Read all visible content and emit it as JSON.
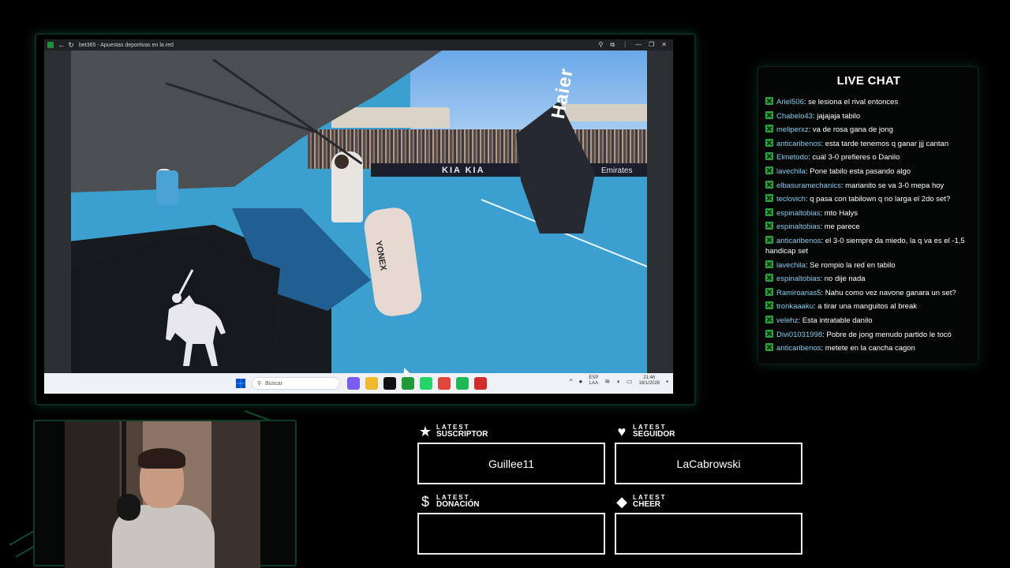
{
  "browser": {
    "tab_title": "bet365 - Apuestas deportivas en la red",
    "overlay_board_text": "KIA  KIA",
    "overlay_board_text2": "Emirates",
    "umpire_chair_text": "Haier",
    "bag_text": "YONEX"
  },
  "taskbar": {
    "search_placeholder": "Buscar",
    "lang_line1": "ESP",
    "lang_line2": "LAA",
    "time": "21:46",
    "date": "18/1/2026",
    "apps": [
      {
        "icon": "copilot-icon",
        "color": "#7b5cf0"
      },
      {
        "icon": "folder-icon",
        "color": "#f3b72a"
      },
      {
        "icon": "tiktok-icon",
        "color": "#111111"
      },
      {
        "icon": "kick-icon",
        "color": "#1f9a3b"
      },
      {
        "icon": "whatsapp-icon",
        "color": "#25d366"
      },
      {
        "icon": "chrome-icon",
        "color": "#e2463a"
      },
      {
        "icon": "spotify-icon",
        "color": "#1db954"
      },
      {
        "icon": "app-icon",
        "color": "#d32c2c"
      }
    ]
  },
  "chat": {
    "title": "LIVE CHAT",
    "messages": [
      {
        "user": "Ariel506",
        "text": ": se lesiona el rival entonces"
      },
      {
        "user": "Chabelo43",
        "text": ": jajajaja tabilo"
      },
      {
        "user": "meliperxz",
        "text": ": va de rosa gana de jong"
      },
      {
        "user": "anticaribenos",
        "text": ": esta tarde tenemos q ganar jjj cantan"
      },
      {
        "user": "Elmetodo",
        "text": ": cuál 3-0 prefieres o Danilo"
      },
      {
        "user": "lavechila",
        "text": ": Pone tabilo esta pasando algo"
      },
      {
        "user": "elbasuramechanics",
        "text": ": marianito se va 3-0 mepa hoy"
      },
      {
        "user": "teclovich",
        "text": ": q pasa con tabilown q no larga el 2do set?"
      },
      {
        "user": "espinaltobias",
        "text": ": mto Halys"
      },
      {
        "user": "espinaltobias",
        "text": ": me parece"
      },
      {
        "user": "anticaribenos",
        "text": ": el 3-0 siempre da miedo, la q va es el -1,5 handicap set"
      },
      {
        "user": "lavechila",
        "text": ": Se rompio la red en tabilo"
      },
      {
        "user": "espinaltobias",
        "text": ": no dije nada"
      },
      {
        "user": "Ramiroarias5",
        "text": ": Nahu como vez navone ganara un set?"
      },
      {
        "user": "tronkaaaku",
        "text": ": a tirar una manguitos al break"
      },
      {
        "user": "velehz",
        "text": ": Esta intratable danilo"
      },
      {
        "user": "Divi01031998",
        "text": ": Pobre de jong menudo partido le tocó"
      },
      {
        "user": "anticaribenos",
        "text": ": metete en la cancha cagon"
      }
    ]
  },
  "alerts": {
    "subscriber": {
      "small": "LATEST",
      "big": "SUSCRIPTOR",
      "value": "Guillee11"
    },
    "follower": {
      "small": "LATEST",
      "big": "SEGUIDOR",
      "value": "LaCabrowski"
    },
    "donation": {
      "small": "LATEST",
      "big": "DONACIÓN",
      "value": ""
    },
    "cheer": {
      "small": "LATEST",
      "big": "CHEER",
      "value": ""
    }
  }
}
